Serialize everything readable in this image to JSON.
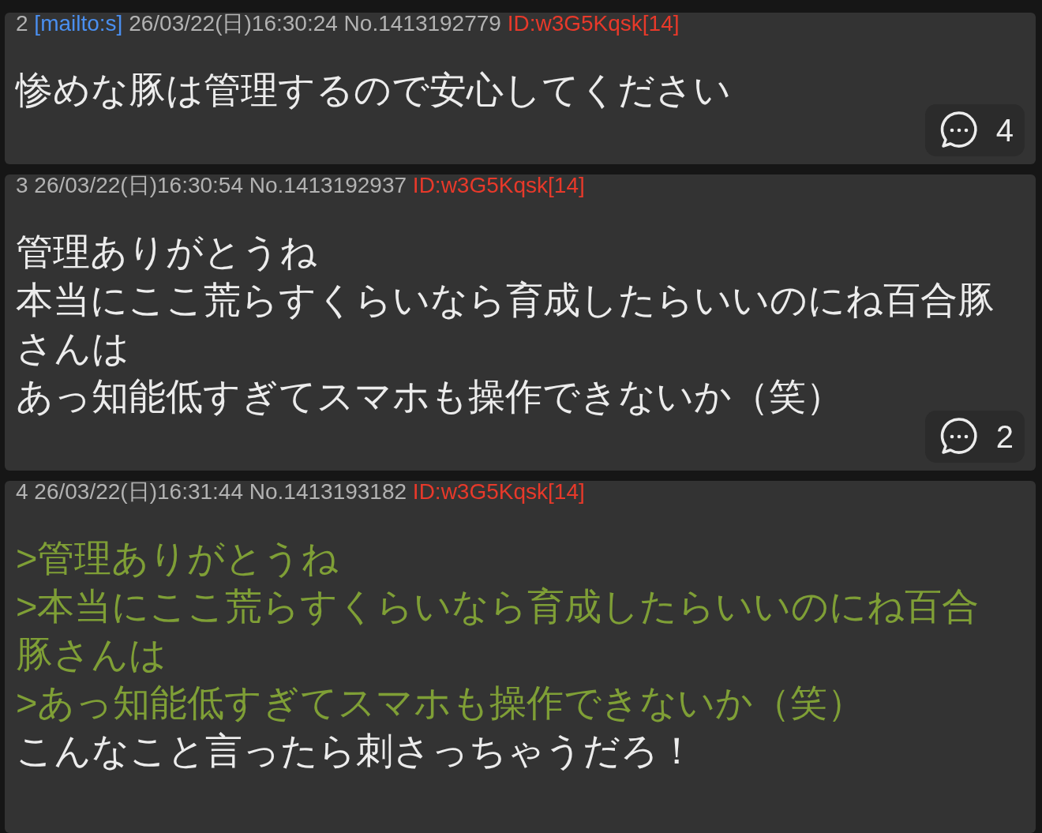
{
  "posts": [
    {
      "number": "2",
      "mail": "[mailto:s]",
      "date": "26/03/22(日)16:30:24",
      "post_no": "No.1413192779",
      "id": "ID:w3G5Kqsk[14]",
      "lines": [
        {
          "kind": "text",
          "text": "惨めな豚は管理するので安心してください"
        }
      ],
      "replies": "4"
    },
    {
      "number": "3",
      "date": "26/03/22(日)16:30:54",
      "post_no": "No.1413192937",
      "id": "ID:w3G5Kqsk[14]",
      "lines": [
        {
          "kind": "text",
          "text": "管理ありがとうね"
        },
        {
          "kind": "text",
          "text": "本当にここ荒らすくらいなら育成したらいいのにね百合豚さんは"
        },
        {
          "kind": "text",
          "text": "あっ知能低すぎてスマホも操作できないか（笑）"
        }
      ],
      "replies": "2"
    },
    {
      "number": "4",
      "date": "26/03/22(日)16:31:44",
      "post_no": "No.1413193182",
      "id": "ID:w3G5Kqsk[14]",
      "lines": [
        {
          "kind": "quote",
          "text": ">管理ありがとうね"
        },
        {
          "kind": "quote",
          "text": ">本当にここ荒らすくらいなら育成したらいいのにね百合豚さんは"
        },
        {
          "kind": "quote",
          "text": ">あっ知能低すぎてスマホも操作できないか（笑）"
        },
        {
          "kind": "text",
          "text": "こんなこと言ったら刺さっちゃうだろ！"
        }
      ]
    }
  ]
}
